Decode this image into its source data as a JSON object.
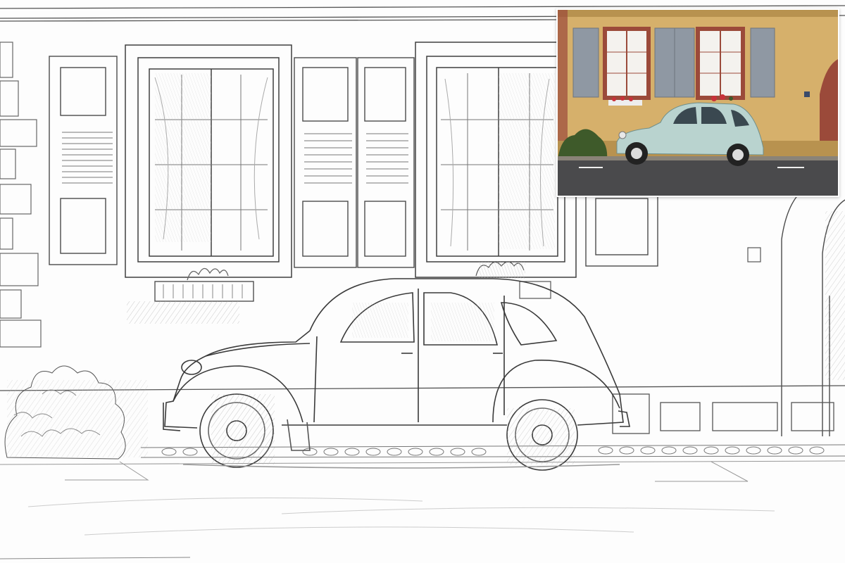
{
  "image": {
    "main_style": "pencil-sketch",
    "inset_style": "color-photo",
    "colors": {
      "pencil": "#3a3a3a",
      "pencil_light": "#9a9a9a",
      "paper": "#fdfdfd",
      "wall": "#d6b06b",
      "wall_shadow": "#b8924f",
      "shutter": "#8f98a3",
      "frame_red": "#9b4a3a",
      "road": "#4a4a4c",
      "car": "#b9d3cf",
      "car_dark": "#8fb1ad",
      "flowers": "#c8323a",
      "bush": "#3e5a2a"
    }
  }
}
